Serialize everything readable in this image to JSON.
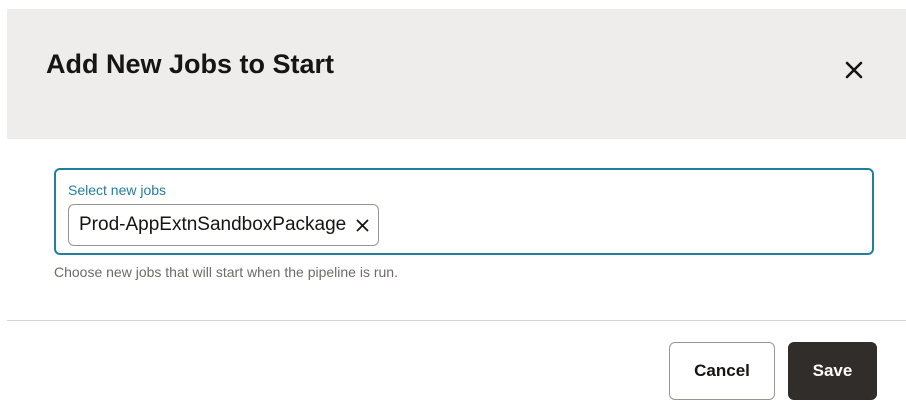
{
  "dialog": {
    "title": "Add New Jobs to Start",
    "close_icon": "close-icon"
  },
  "jobs_field": {
    "label": "Select new jobs",
    "selected": [
      {
        "label": "Prod-AppExtnSandboxPackage",
        "remove_icon": "close-icon"
      }
    ],
    "help_text": "Choose new jobs that will start when the pipeline is run."
  },
  "footer": {
    "cancel_label": "Cancel",
    "save_label": "Save"
  },
  "colors": {
    "header_bg": "#efedec",
    "focus_border": "#227e9e",
    "primary_button": "#312d2a",
    "text": "#161513",
    "help_text": "#6f6a64"
  }
}
